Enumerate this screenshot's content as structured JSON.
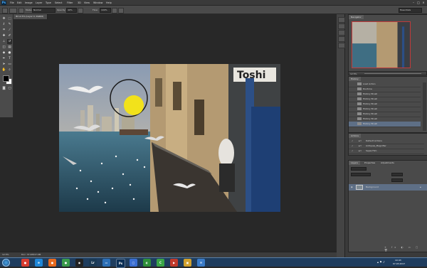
{
  "app": {
    "logo": "Ps"
  },
  "menubar": {
    "items": [
      "File",
      "Edit",
      "Image",
      "Layer",
      "Type",
      "Select",
      "Filter",
      "3D",
      "View",
      "Window",
      "Help"
    ],
    "workspace": "Essentials"
  },
  "options": {
    "mode_label": "Mode:",
    "mode_value": "Normal",
    "opacity_label": "Opacity:",
    "opacity_value": "40%",
    "flow_label": "Flow:",
    "flow_value": "100%"
  },
  "document": {
    "tab_title": "IB 12.5% (Layer 0, RGB/8)",
    "zoom": "12.5%",
    "doc_info": "Doc: 37.0M/37.0M"
  },
  "navigator": {
    "tab": "Navigator",
    "zoom": "12.5%"
  },
  "history": {
    "tab": "History",
    "items": [
      "Load Action",
      "Duotone",
      "History Brush",
      "History Brush",
      "History Brush",
      "History Brush",
      "History Brush",
      "History Brush",
      "History Brush"
    ]
  },
  "actions": {
    "tab": "Actions",
    "items": [
      "Default Actions",
      "Antiques_Magnifier",
      "Sepia Film"
    ]
  },
  "layers": {
    "tabs": [
      "Layers",
      "Properties",
      "Adjustments"
    ],
    "layer_name": "Background"
  },
  "taskbar": {
    "time": "10:43",
    "date": "07.03.2017",
    "apps": [
      {
        "icon": "chrome-icon",
        "color": "#d63b2f",
        "glyph": "●"
      },
      {
        "icon": "ie-icon",
        "color": "#1f87d8",
        "glyph": "e"
      },
      {
        "icon": "firefox-icon",
        "color": "#e86a1e",
        "glyph": "●"
      },
      {
        "icon": "chrome2-icon",
        "color": "#3a9a4a",
        "glyph": "●"
      },
      {
        "icon": "player-icon",
        "color": "#222",
        "glyph": "◉"
      },
      {
        "icon": "lightroom-icon",
        "color": "#1b3a55",
        "glyph": "Lr"
      },
      {
        "icon": "monitor-icon",
        "color": "#2c6fb6",
        "glyph": "▭"
      },
      {
        "icon": "photoshop-icon",
        "color": "#0b2f55",
        "glyph": "Ps"
      },
      {
        "icon": "bridge-icon",
        "color": "#3b6fd3",
        "glyph": "▢"
      },
      {
        "icon": "app-green-icon",
        "color": "#2f8f3a",
        "glyph": "◐"
      },
      {
        "icon": "camtasia-icon",
        "color": "#3aa546",
        "glyph": "C"
      },
      {
        "icon": "media-icon",
        "color": "#c0392b",
        "glyph": "▶"
      },
      {
        "icon": "files-icon",
        "color": "#d1a02d",
        "glyph": "▣"
      },
      {
        "icon": "mail-icon",
        "color": "#3a7bc8",
        "glyph": "✉"
      }
    ]
  },
  "colors": {
    "foreground": "#000000",
    "background": "#ffffff",
    "accent": "#4fb0ff"
  }
}
